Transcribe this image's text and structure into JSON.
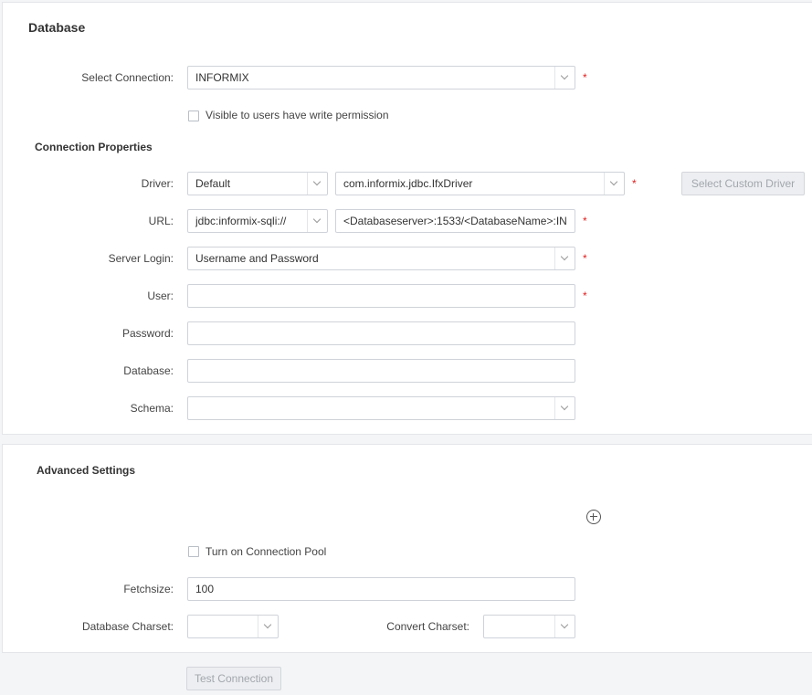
{
  "database": {
    "title": "Database",
    "select_connection_label": "Select Connection:",
    "select_connection_value": "INFORMIX",
    "visible_label": "Visible to users have write permission"
  },
  "connection_properties": {
    "title": "Connection Properties",
    "driver_label": "Driver:",
    "driver_type_value": "Default",
    "driver_class_value": "com.informix.jdbc.IfxDriver",
    "custom_driver_button": "Select Custom Driver",
    "url_label": "URL:",
    "url_prefix_value": "jdbc:informix-sqli://",
    "url_value": "<Databaseserver>:1533/<DatabaseName>:IN",
    "server_login_label": "Server Login:",
    "server_login_value": "Username and Password",
    "user_label": "User:",
    "user_value": "",
    "password_label": "Password:",
    "password_value": "",
    "database_label": "Database:",
    "database_value": "",
    "schema_label": "Schema:",
    "schema_value": ""
  },
  "advanced": {
    "title": "Advanced Settings",
    "add_icon": "plus-circle-icon",
    "pool_label": "Turn on Connection Pool",
    "fetchsize_label": "Fetchsize:",
    "fetchsize_value": "100",
    "db_charset_label": "Database Charset:",
    "db_charset_value": "",
    "convert_charset_label": "Convert Charset:",
    "convert_charset_value": ""
  },
  "footer": {
    "test_connection_button": "Test Connection"
  },
  "required_marker": "*"
}
